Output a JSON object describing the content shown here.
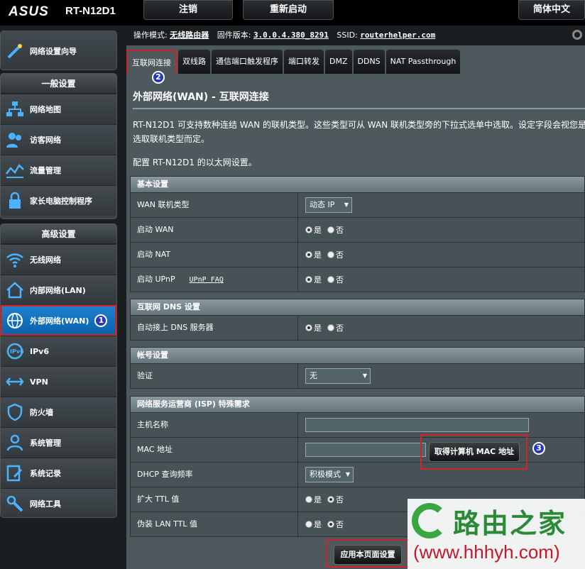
{
  "header": {
    "logo": "ASUS",
    "model": "RT-N12D1",
    "logout": "注销",
    "reboot": "重新启动",
    "language": "简体中文"
  },
  "info": {
    "mode_label": "操作模式:",
    "mode": "无线路由器",
    "fw_label": "固件版本:",
    "fw": "3.0.0.4.380_8291",
    "ssid_label": "SSID:",
    "ssid": "routerhelper.com"
  },
  "sidebar": {
    "wizard": "网络设置向导",
    "general_title": "一般设置",
    "general": [
      "网络地图",
      "访客网络",
      "流量管理",
      "家长电脑控制程序"
    ],
    "advanced_title": "高级设置",
    "advanced": [
      "无线网络",
      "内部网络(LAN)",
      "外部网络(WAN)",
      "IPv6",
      "VPN",
      "防火墙",
      "系统管理",
      "系统记录",
      "网络工具"
    ],
    "active_badge": "1"
  },
  "tabs": [
    "互联网连接",
    "双线路",
    "通信端口触发程序",
    "端口转发",
    "DMZ",
    "DDNS",
    "NAT Passthrough"
  ],
  "tab_badge": "2",
  "page": {
    "title": "外部网络(WAN) - 互联网连接",
    "desc": "RT-N12D1 可支持数种连结 WAN 的联机类型。这些类型可从 WAN 联机类型旁的下拉式选单中选取。设定字段会视您是选取联机类型而定。",
    "desc2": "配置 RT-N12D1 的以太网设置。"
  },
  "basic": {
    "title": "基本设置",
    "wan_type_label": "WAN 联机类型",
    "wan_type": "动态 IP",
    "enable_wan": "启动 WAN",
    "enable_nat": "启动 NAT",
    "enable_upnp": "启动 UPnP",
    "upnp_faq": "UPnP FAQ",
    "yes": "是",
    "no": "否"
  },
  "dns": {
    "title": "互联网 DNS 设置",
    "auto_dns": "自动接上 DNS 服务器"
  },
  "account": {
    "title": "帐号设置",
    "auth": "验证",
    "auth_value": "无"
  },
  "isp": {
    "title": "网络服务运营商 (ISP) 特殊需求",
    "hostname": "主机名称",
    "mac": "MAC 地址",
    "mac_btn": "取得计算机 MAC 地址",
    "mac_badge": "3",
    "dhcp": "DHCP 查询频率",
    "dhcp_value": "积极模式",
    "ttl": "扩大 TTL 值",
    "lan_ttl": "伪装 LAN TTL 值"
  },
  "apply": "应用本页面设置",
  "watermark": {
    "name": "路由之家",
    "url": "(www.hhhyh.com)"
  }
}
